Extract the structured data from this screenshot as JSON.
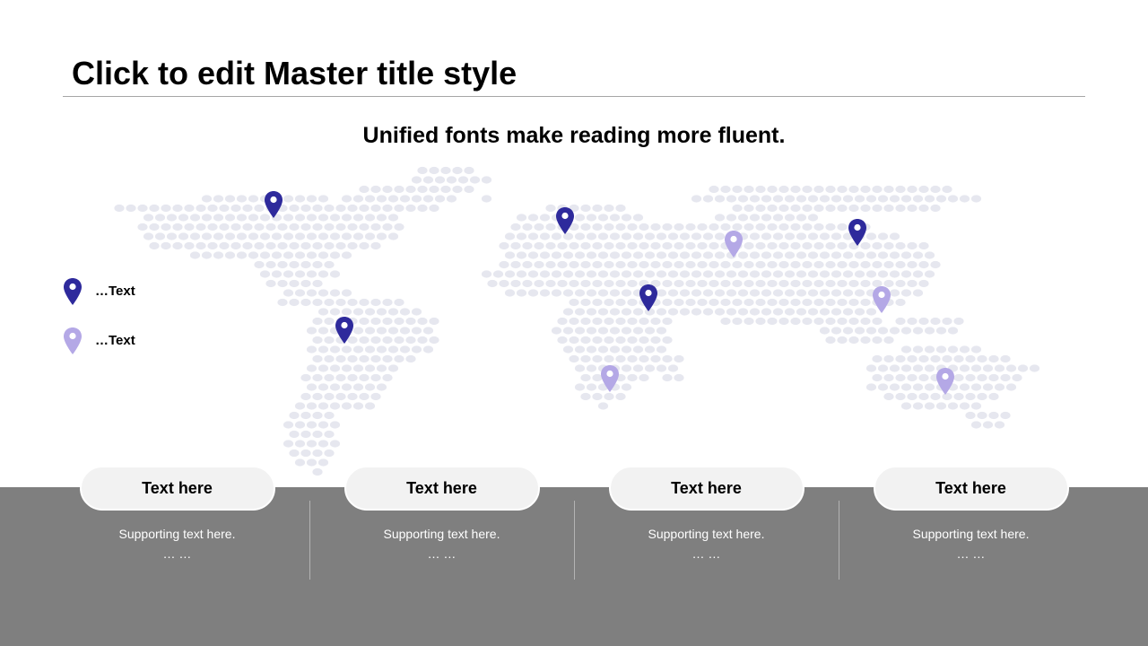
{
  "title": "Click to edit Master title style",
  "subtitle": "Unified fonts make reading more fluent.",
  "colors": {
    "pin_dark": "#2e2a9c",
    "pin_light": "#b4a8e6",
    "map_dot": "#e6e7ef",
    "band": "#7f7f7f",
    "pill": "#f2f2f2"
  },
  "legend": [
    {
      "label": "…Text",
      "color": "#2e2a9c"
    },
    {
      "label": "…Text",
      "color": "#b4a8e6"
    }
  ],
  "cards": [
    {
      "title": "Text here",
      "support": "Supporting text here.",
      "more": "… …"
    },
    {
      "title": "Text here",
      "support": "Supporting text here.",
      "more": "… …"
    },
    {
      "title": "Text here",
      "support": "Supporting text here.",
      "more": "… …"
    },
    {
      "title": "Text here",
      "support": "Supporting text here.",
      "more": "… …"
    }
  ]
}
